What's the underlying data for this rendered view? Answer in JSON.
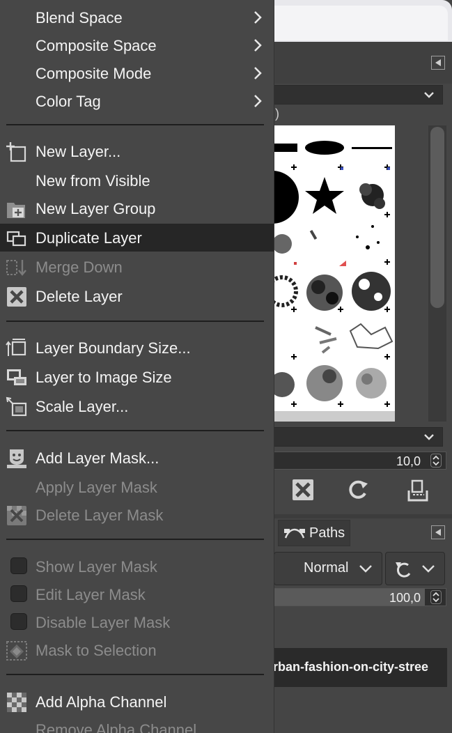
{
  "menu": {
    "submenus": [
      {
        "label": "Blend Space"
      },
      {
        "label": "Composite Space"
      },
      {
        "label": "Composite Mode"
      },
      {
        "label": "Color Tag"
      }
    ],
    "layer_items": [
      {
        "label": "New Layer...",
        "icon": "new-layer-icon"
      },
      {
        "label": "New from Visible",
        "icon": ""
      },
      {
        "label": "New Layer Group",
        "icon": "new-layer-group-icon"
      },
      {
        "label": "Duplicate Layer",
        "icon": "duplicate-layer-icon",
        "highlighted": true
      },
      {
        "label": "Merge Down",
        "icon": "merge-down-icon",
        "disabled": true
      },
      {
        "label": "Delete Layer",
        "icon": "delete-layer-icon"
      }
    ],
    "size_items": [
      {
        "label": "Layer Boundary Size...",
        "icon": "layer-boundary-size-icon"
      },
      {
        "label": "Layer to Image Size",
        "icon": "layer-to-image-size-icon"
      },
      {
        "label": "Scale Layer...",
        "icon": "scale-layer-icon"
      }
    ],
    "mask_items": [
      {
        "label": "Add Layer Mask...",
        "icon": "add-layer-mask-icon"
      },
      {
        "label": "Apply Layer Mask",
        "disabled": true
      },
      {
        "label": "Delete Layer Mask",
        "icon": "delete-layer-mask-icon",
        "disabled": true
      }
    ],
    "mask_toggles": [
      {
        "label": "Show Layer Mask",
        "disabled": true
      },
      {
        "label": "Edit Layer Mask",
        "disabled": true
      },
      {
        "label": "Disable Layer Mask",
        "disabled": true
      },
      {
        "label": "Mask to Selection",
        "icon": "mask-to-selection-icon",
        "disabled": true
      }
    ],
    "alpha_items": [
      {
        "label": "Add Alpha Channel",
        "icon": "add-alpha-channel-icon"
      },
      {
        "label": "Remove Alpha Channel",
        "disabled": true
      }
    ]
  },
  "background": {
    "brushes": {
      "tag_text": ")",
      "spacing_value": "10,0"
    },
    "layers": {
      "paths_tab": "Paths",
      "mode_value": "Normal",
      "opacity_value": "100,0",
      "layer_name": "urban-fashion-on-city-stree"
    }
  },
  "colors": {
    "menu_bg": "#474747",
    "highlight_bg": "#262626",
    "disabled_text": "#8c8c8c",
    "text": "#f4f4f4"
  }
}
